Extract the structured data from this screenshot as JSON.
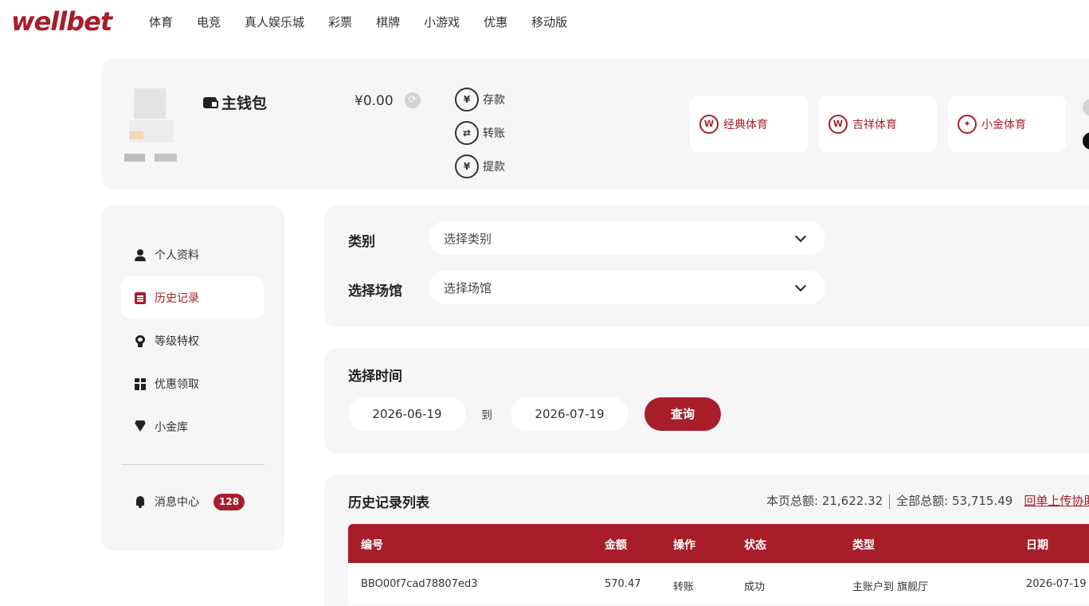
{
  "header": {
    "logo": "wellbet",
    "nav": [
      "体育",
      "电竞",
      "真人娱乐城",
      "彩票",
      "棋牌",
      "小游戏",
      "优惠",
      "移动版"
    ]
  },
  "wallet": {
    "title": "主钱包",
    "balance": "¥0.00",
    "actions": [
      {
        "label": "存款",
        "icon": "deposit-icon"
      },
      {
        "label": "转账",
        "icon": "transfer-icon"
      },
      {
        "label": "提款",
        "icon": "withdraw-icon"
      }
    ],
    "venues": [
      {
        "label": "经典体育",
        "icon": "classic-sports-icon"
      },
      {
        "label": "吉祥体育",
        "icon": "lucky-sports-icon"
      },
      {
        "label": "小金体育",
        "icon": "gold-sports-icon"
      }
    ]
  },
  "sidebar": {
    "items": [
      {
        "label": "个人资料",
        "icon": "user-icon"
      },
      {
        "label": "历史记录",
        "icon": "document-icon",
        "active": true
      },
      {
        "label": "等级特权",
        "icon": "medal-icon"
      },
      {
        "label": "优惠领取",
        "icon": "gift-icon"
      },
      {
        "label": "小金库",
        "icon": "diamond-icon"
      }
    ],
    "messages": {
      "label": "消息中心",
      "icon": "bell-icon",
      "count": "128"
    }
  },
  "filters": {
    "category_label": "类别",
    "category_value": "选择类别",
    "venue_label": "选择场馆",
    "venue_value": "选择场馆"
  },
  "time": {
    "title": "选择时间",
    "start": "2026-06-19",
    "to": "到",
    "end": "2026-07-19",
    "query": "查询"
  },
  "history": {
    "title": "历史记录列表",
    "page_total": "本页总额: 21,622.32",
    "all_total": "全部总额: 53,715.49",
    "upload_link": "回单上传协助",
    "columns": [
      "编号",
      "金额",
      "操作",
      "状态",
      "类型",
      "日期"
    ],
    "rows": [
      [
        "BBO00f7cad78807ed3",
        "570.47",
        "转账",
        "成功",
        "主账户到 旗舰厅",
        "2026-07-19"
      ]
    ]
  },
  "colors": {
    "brand": "#a71d2a",
    "panel": "#f6f6f7"
  }
}
